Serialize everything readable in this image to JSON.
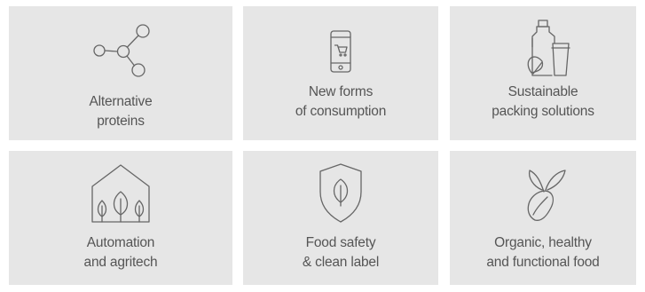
{
  "tiles": [
    {
      "icon": "molecule-icon",
      "line1": "Alternative",
      "line2": "proteins"
    },
    {
      "icon": "smartphone-cart-icon",
      "line1": "New forms",
      "line2": "of consumption"
    },
    {
      "icon": "packaging-leaf-icon",
      "line1": "Sustainable",
      "line2": "packing solutions"
    },
    {
      "icon": "greenhouse-icon",
      "line1": "Automation",
      "line2": "and agritech"
    },
    {
      "icon": "shield-leaf-icon",
      "line1": "Food safety",
      "line2": "& clean label"
    },
    {
      "icon": "seed-sprout-icon",
      "line1": "Organic, healthy",
      "line2": "and functional food"
    }
  ],
  "colors": {
    "tile_background": "#e6e6e6",
    "text": "#555555",
    "icon_stroke": "#666666"
  }
}
